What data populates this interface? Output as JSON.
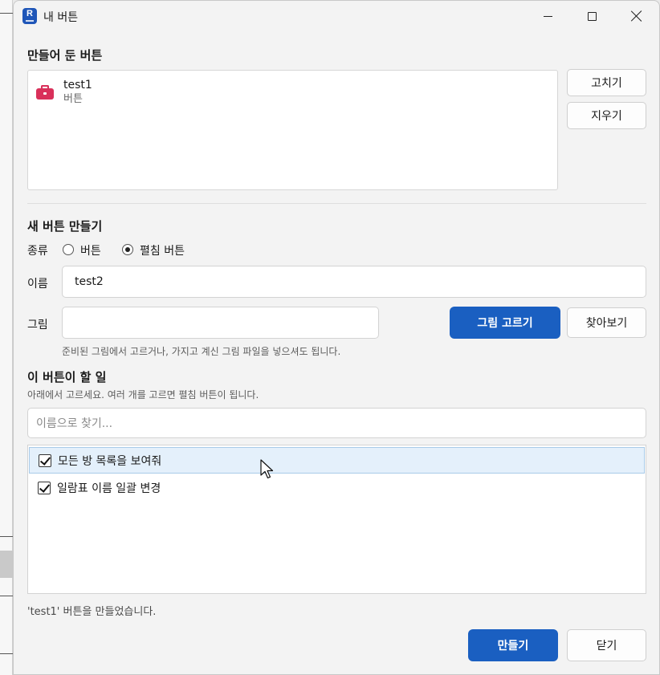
{
  "window": {
    "title": "내 버튼",
    "app_icon_letter": "R"
  },
  "saved_buttons": {
    "section_title": "만들어 둔 버튼",
    "items": [
      {
        "name": "test1",
        "type": "버튼",
        "icon": "toolbox-icon"
      }
    ],
    "edit_label": "고치기",
    "delete_label": "지우기"
  },
  "new_button": {
    "section_title": "새 버튼 만들기",
    "kind_label": "종류",
    "kind_options": [
      "버튼",
      "펼침 버튼"
    ],
    "kind_selected": "펼침 버튼",
    "name_label": "이름",
    "name_value": "test2",
    "image_label": "그림",
    "image_value": "",
    "pick_image_label": "그림 고르기",
    "browse_label": "찾아보기",
    "image_hint": "준비된 그림에서 고르거나, 가지고 계신 그림 파일을 넣으셔도 됩니다."
  },
  "actions": {
    "section_title": "이 버튼이 할 일",
    "hint": "아래에서 고르세요. 여러 개를 고르면 펼침 버튼이 됩니다.",
    "search_placeholder": "이름으로 찾기...",
    "items": [
      {
        "label": "모든 방 목록을 보여줘",
        "checked": true
      },
      {
        "label": "일람표 이름 일괄 변경",
        "checked": true
      }
    ]
  },
  "status_message": "'test1' 버튼을 만들었습니다.",
  "footer": {
    "create_label": "만들기",
    "close_label": "닫기"
  },
  "colors": {
    "primary": "#1a5fc1",
    "window_bg": "#f3f3f3",
    "row_hover": "#e4f0fb",
    "toolbox_icon": "#d9305a"
  }
}
